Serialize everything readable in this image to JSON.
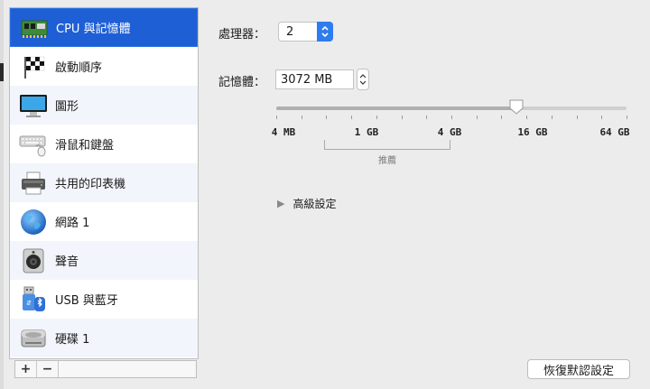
{
  "sidebar": {
    "items": [
      {
        "label": "CPU 與記憶體",
        "icon": "memory-chip-icon",
        "selected": true
      },
      {
        "label": "啟動順序",
        "icon": "race-flag-icon"
      },
      {
        "label": "圖形",
        "icon": "monitor-icon"
      },
      {
        "label": "滑鼠和鍵盤",
        "icon": "keyboard-mouse-icon"
      },
      {
        "label": "共用的印表機",
        "icon": "printer-icon"
      },
      {
        "label": "網路 1",
        "icon": "globe-icon"
      },
      {
        "label": "聲音",
        "icon": "speaker-icon"
      },
      {
        "label": "USB 與藍牙",
        "icon": "usb-bluetooth-icon"
      },
      {
        "label": "硬碟 1",
        "icon": "hard-disk-icon"
      }
    ],
    "add_label": "+",
    "remove_label": "−"
  },
  "cpu": {
    "label": "處理器：",
    "value": "2"
  },
  "memory": {
    "label": "記憶體：",
    "value": "3072 MB",
    "slider": {
      "value_mb": 3072,
      "tick_labels": [
        "4 MB",
        "1 GB",
        "4 GB",
        "16 GB",
        "64 GB"
      ],
      "recommended_label": "推薦"
    }
  },
  "advanced": {
    "label": "高級設定"
  },
  "restore_button": {
    "label": "恢復默認設定"
  },
  "colors": {
    "selection": "#1f5fd6",
    "accent": "#2f7cf0",
    "window_bg": "#ececec"
  }
}
